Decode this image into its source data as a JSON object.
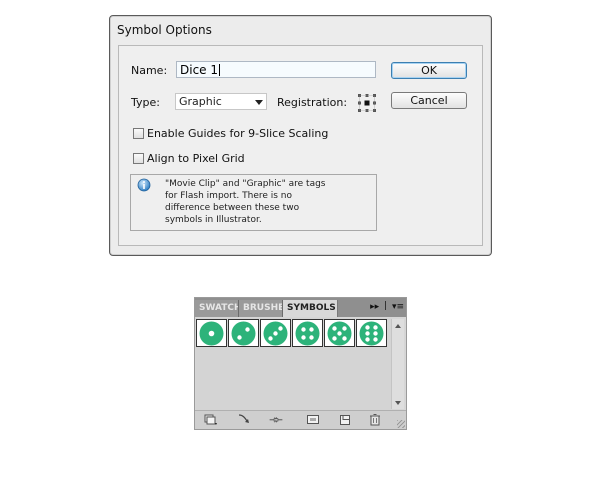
{
  "dialog": {
    "title": "Symbol Options",
    "name_label": "Name:",
    "name_value": "Dice 1",
    "type_label": "Type:",
    "type_value": "Graphic",
    "registration_label": "Registration:",
    "ok_label": "OK",
    "cancel_label": "Cancel",
    "nine_slice_label": "Enable Guides for 9-Slice Scaling",
    "nine_slice_checked": false,
    "pixel_grid_label": "Align to Pixel Grid",
    "pixel_grid_checked": false,
    "info_text": "\"Movie Clip\" and \"Graphic\" are tags\nfor Flash import. There is no\ndifference between these two\nsymbols in Illustrator."
  },
  "panel": {
    "tabs": [
      {
        "label": "SWATCHES",
        "active": false
      },
      {
        "label": "BRUSHES",
        "active": false
      },
      {
        "label": "SYMBOLS",
        "active": true
      }
    ],
    "symbols": [
      {
        "name": "dice-1",
        "pips": 1
      },
      {
        "name": "dice-2",
        "pips": 2
      },
      {
        "name": "dice-3",
        "pips": 3
      },
      {
        "name": "dice-4",
        "pips": 4
      },
      {
        "name": "dice-5",
        "pips": 5
      },
      {
        "name": "dice-6",
        "pips": 6
      }
    ],
    "bottom_icons": [
      "symbol-libraries-menu-icon",
      "place-symbol-instance-icon",
      "break-link-icon",
      "symbol-options-icon",
      "new-symbol-icon",
      "delete-symbol-icon"
    ]
  },
  "colors": {
    "dice_green": "#2db37a",
    "pip_white": "#ffffff"
  }
}
